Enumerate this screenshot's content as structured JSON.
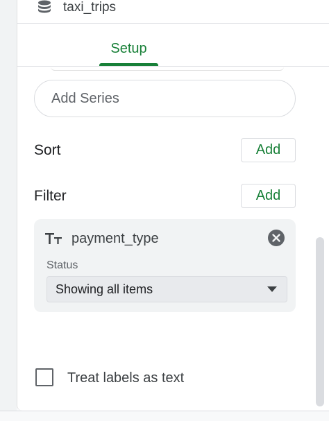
{
  "source": {
    "name": "taxi_trips",
    "icon": "database-icon"
  },
  "tabs": [
    {
      "label": "Setup",
      "active": true
    }
  ],
  "add_series": {
    "label": "Add Series"
  },
  "sort": {
    "label": "Sort",
    "add_label": "Add"
  },
  "filter": {
    "label": "Filter",
    "add_label": "Add",
    "items": [
      {
        "field": "payment_type",
        "field_icon": "text-type-icon",
        "status_label": "Status",
        "status_value": "Showing all items"
      }
    ]
  },
  "options": {
    "treat_labels_as_text": {
      "label": "Treat labels as text",
      "checked": false
    }
  },
  "colors": {
    "accent": "#188038",
    "text": "#202124",
    "muted": "#5f6368",
    "card_bg": "#f1f3f4"
  }
}
